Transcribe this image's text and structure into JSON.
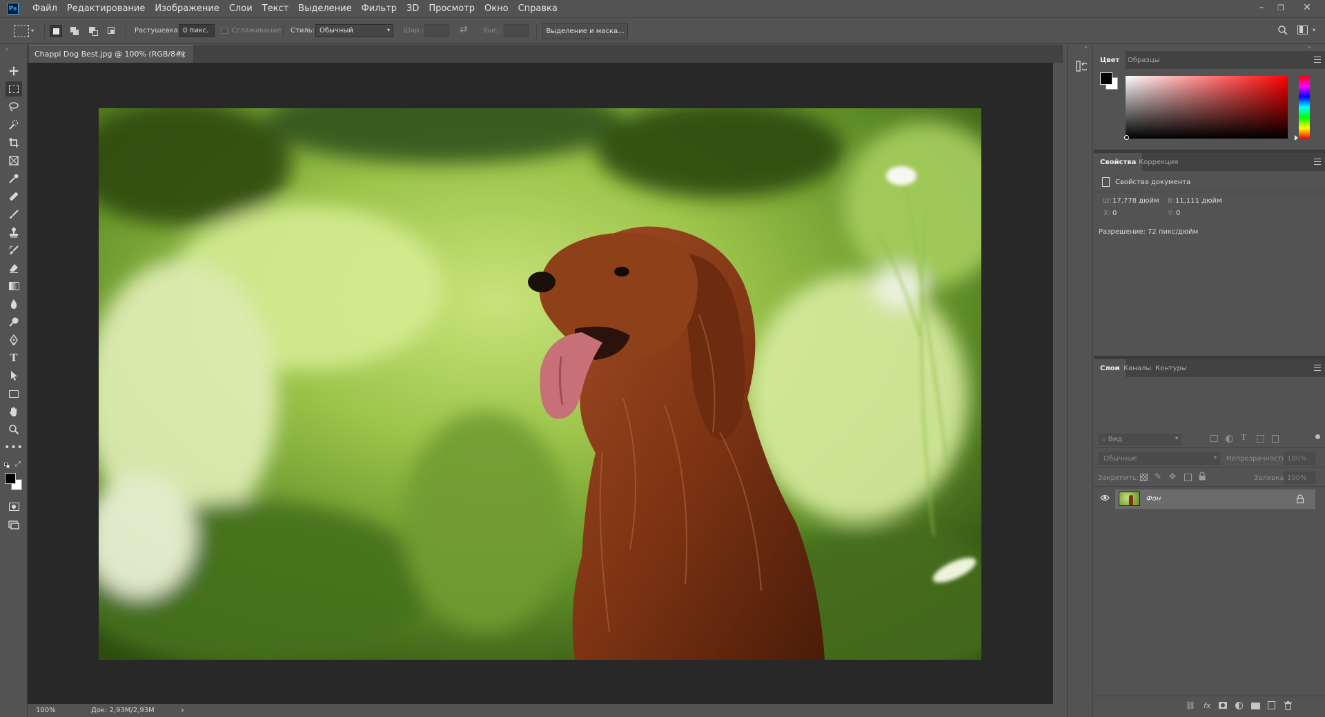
{
  "app": {
    "logo": "Ps",
    "menu": [
      "Файл",
      "Редактирование",
      "Изображение",
      "Слои",
      "Текст",
      "Выделение",
      "Фильтр",
      "3D",
      "Просмотр",
      "Окно",
      "Справка"
    ],
    "window_controls": {
      "minimize": "–",
      "restore": "❐",
      "close": "✕"
    }
  },
  "options": {
    "feather_label": "Растушевка:",
    "feather_value": "0 пикс.",
    "antialias_label": "Сглаживание",
    "style_label": "Стиль:",
    "style_value": "Обычный",
    "width_label": "Шир.:",
    "height_label": "Выс.:",
    "mask_button": "Выделение и маска..."
  },
  "document": {
    "tab_title": "Chappi Dog Best.jpg @ 100% (RGB/8#)",
    "tab_close": "×",
    "zoom": "100%",
    "doc_size": "Док: 2,93M/2,93M",
    "status_arrow": "›"
  },
  "color_panel": {
    "tabs": [
      "Цвет",
      "Образцы"
    ],
    "active_tab": "Цвет",
    "foreground": "#000000",
    "background": "#ffffff",
    "hue": "#ff0000"
  },
  "properties_panel": {
    "tabs": [
      "Свойства",
      "Коррекция"
    ],
    "active_tab": "Свойства",
    "header": "Свойства документа",
    "width_label": "Ш:",
    "width_value": "17,778 дюйм",
    "height_label": "В:",
    "height_value": "11,111 дюйм",
    "x_label": "X:",
    "x_value": "0",
    "y_label": "Y:",
    "y_value": "0",
    "resolution": "Разрешение: 72 пикс/дюйм"
  },
  "layers_panel": {
    "tabs": [
      "Слои",
      "Каналы",
      "Контуры"
    ],
    "active_tab": "Слои",
    "filter_placeholder": "Вид",
    "blend_mode": "Обычные",
    "opacity_label": "Непрозрачность:",
    "opacity_value": "100%",
    "lock_label": "Закрепить:",
    "fill_label": "Заливка:",
    "fill_value": "100%",
    "layers": [
      {
        "name": "Фон",
        "visible": true,
        "locked": true
      }
    ],
    "bottom_icons": [
      "link-icon",
      "fx-icon",
      "mask-icon",
      "adjustment-icon",
      "group-icon",
      "new-layer-icon",
      "trash-icon"
    ]
  }
}
